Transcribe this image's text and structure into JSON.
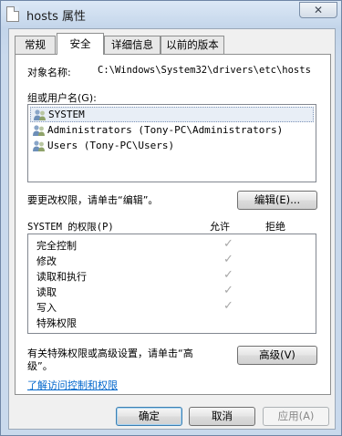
{
  "window": {
    "title": "hosts 属性",
    "close_label": "✕"
  },
  "tabs": [
    {
      "label": "常规"
    },
    {
      "label": "安全"
    },
    {
      "label": "详细信息"
    },
    {
      "label": "以前的版本"
    }
  ],
  "security": {
    "object_name_label": "对象名称:",
    "object_name_value": "C:\\Windows\\System32\\drivers\\etc\\hosts",
    "groups_label": "组或用户名(G):",
    "users": [
      {
        "name": "SYSTEM"
      },
      {
        "name": "Administrators (Tony-PC\\Administrators)"
      },
      {
        "name": "Users (Tony-PC\\Users)"
      }
    ],
    "change_hint": "要更改权限，请单击“编辑”。",
    "edit_button": "编辑(E)...",
    "perm_header": "SYSTEM 的权限(P)",
    "allow_header": "允许",
    "deny_header": "拒绝",
    "permissions": [
      {
        "name": "完全控制",
        "allow": "✓"
      },
      {
        "name": "修改",
        "allow": "✓"
      },
      {
        "name": "读取和执行",
        "allow": "✓"
      },
      {
        "name": "读取",
        "allow": "✓"
      },
      {
        "name": "写入",
        "allow": "✓"
      },
      {
        "name": "特殊权限",
        "allow": ""
      }
    ],
    "advanced_hint_1": "有关特殊权限或高级设置，请单击“高",
    "advanced_hint_2": "级”。",
    "advanced_button": "高级(V)",
    "learn_link": "了解访问控制和权限"
  },
  "footer": {
    "ok": "确定",
    "cancel": "取消",
    "apply": "应用(A)"
  }
}
